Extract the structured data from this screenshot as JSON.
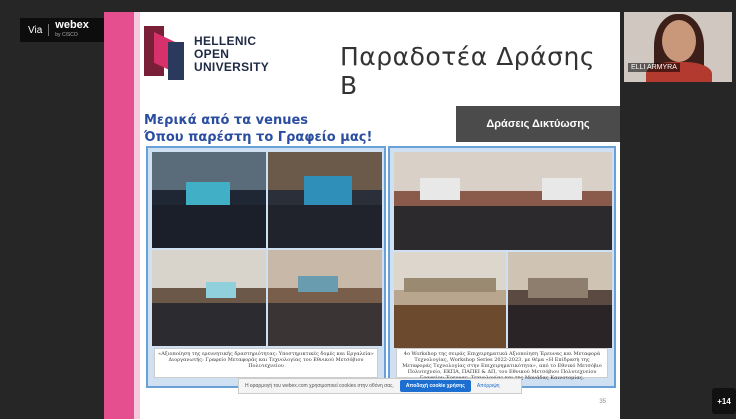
{
  "webex_badge": {
    "via": "Via",
    "brand": "webex",
    "sub": "by CISCO"
  },
  "slide": {
    "logo_lines": [
      "HELLENIC",
      "OPEN",
      "UNIVERSITY"
    ],
    "title": "Παραδοτέα Δράσης Β",
    "venues_line1": "Μερικά από τα venues",
    "venues_line2": "Όπου παρέστη το Γραφείο μας!",
    "networking_label": "Δράσεις Δικτύωσης",
    "left_caption": "«Αξιοποίηση της ερευνητικής δραστηριότητας: Υποστηρικτικές δομές και Εργαλεία» Διοργανωτής: Γραφείο Μεταφοράς και Τεχνολογίας του Εθνικού Μετσόβιου Πολυτεχνείου",
    "right_caption": "4ο Workshop της σειράς Επιχειρηματικά Αξιοποίηση Έρευνας και Μεταφορά Τεχνολογίας, Workshop Series 2022-2023, με θέμα «Η Επίδραση της Μεταφοράς Τεχνολογίας στην Επιχειρηματικότητα», από το Εθνικό Μετσόβιο Πολυτεχνείο, ΕΚΠΑ, ΠΑΠΕΙ & ΔΠ, του Εθνικού Μετσόβιου Πολυτεχνείου Γραφείου Έρευνας, Τεχνολογίας και της Μονάδας Καινοτομίας.",
    "page_number": "35"
  },
  "cookie_bar": {
    "text": "Η εφαρμογή του webex.com χρησιμοποιεί cookies στην οθόνη σας.",
    "accept_label": "Αποδοχή cookie χρήσης",
    "more_label": "Απόρριψη"
  },
  "participant": {
    "name": "ELLI ARMYRA"
  },
  "more_participants": "+14",
  "colors": {
    "accent_pink": "#e54f8f",
    "panel_border": "#6aa0d8",
    "title_blue": "#2b4ea0"
  }
}
